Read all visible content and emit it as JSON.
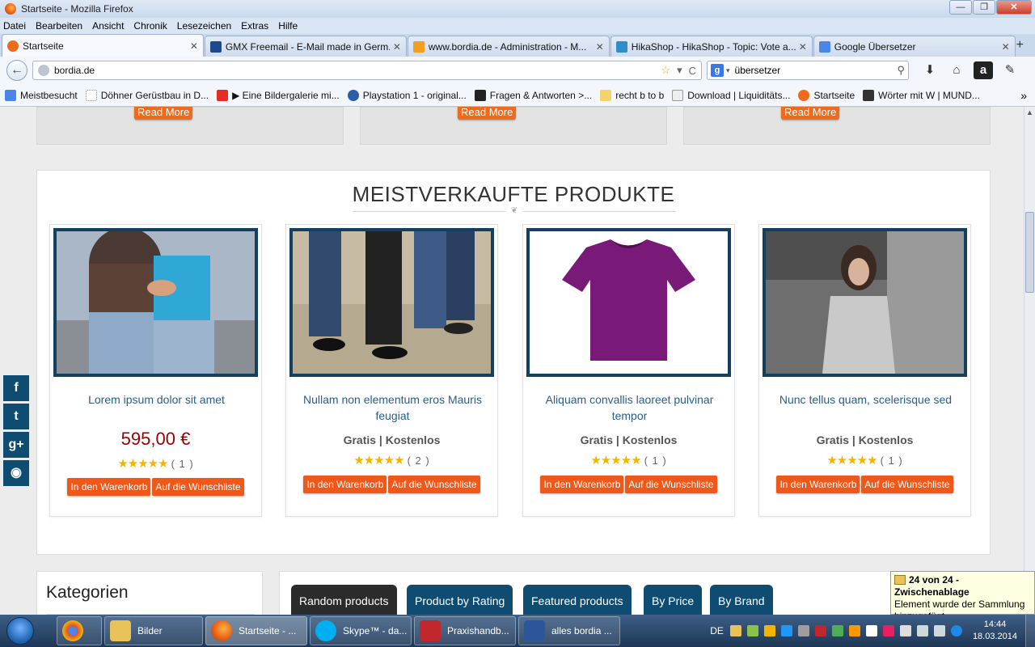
{
  "window": {
    "title": "Startseite - Mozilla Firefox",
    "min": "—",
    "max": "❐",
    "close": "✕"
  },
  "menu": [
    "Datei",
    "Bearbeiten",
    "Ansicht",
    "Chronik",
    "Lesezeichen",
    "Extras",
    "Hilfe"
  ],
  "tabs": [
    {
      "label": "Startseite",
      "color": "#f06a1c",
      "close": "✕"
    },
    {
      "label": "GMX Freemail - E-Mail made in Germ...",
      "color": "#1c4a8c",
      "close": "✕"
    },
    {
      "label": "www.bordia.de - Administration - M...",
      "color": "#f0a020",
      "close": "✕"
    },
    {
      "label": "HikaShop - HikaShop - Topic: Vote a...",
      "color": "#2c8fc9",
      "close": "✕"
    },
    {
      "label": "Google Übersetzer",
      "color": "#4a86e8",
      "close": "✕"
    }
  ],
  "newtab": "+",
  "nav": {
    "back": "←",
    "url": "bordia.de",
    "star": "☆",
    "dropdown": "▾",
    "reload": "C",
    "search_engine": "g",
    "search_value": "übersetzer",
    "search_caret": "▾",
    "search_btn": "⚲",
    "icons": [
      "⬇",
      "⌂",
      "a",
      "✎"
    ]
  },
  "bookmarks": [
    {
      "label": "Meistbesucht",
      "color": "#4a86e8"
    },
    {
      "label": "Döhner Gerüstbau in D...",
      "color": "#dddddd"
    },
    {
      "label": "▶ Eine Bildergalerie mi...",
      "color": "#e52d27"
    },
    {
      "label": "Playstation 1 - original...",
      "color": "#2c5fa8"
    },
    {
      "label": "Fragen & Antworten >...",
      "color": "#222222"
    },
    {
      "label": "recht b to b",
      "color": "#f3d36b"
    },
    {
      "label": "Download | Liquiditäts...",
      "color": "#eeeeee"
    },
    {
      "label": "Startseite",
      "color": "#f06a1c"
    },
    {
      "label": "Wörter mit W | MUND...",
      "color": "#333333"
    }
  ],
  "bookmarks_more": "»",
  "page": {
    "read_more": "Read More",
    "bestsellers_title": "MEISTVERKAUFTE PRODUKTE",
    "ornament": "❦",
    "products": [
      {
        "name": "Lorem ipsum dolor sit amet",
        "price": "595,00 €",
        "stars": "★★★★★",
        "count": "( 1 )"
      },
      {
        "name": "Nullam non elementum eros Mauris feugiat",
        "price": "Gratis | Kostenlos",
        "stars": "★★★★★",
        "count": "( 2 )"
      },
      {
        "name": "Aliquam convallis laoreet pulvinar tempor",
        "price": "Gratis | Kostenlos",
        "stars": "★★★★★",
        "count": "( 1 )"
      },
      {
        "name": "Nunc tellus quam, scelerisque sed",
        "price": "Gratis | Kostenlos",
        "stars": "★★★★★",
        "count": "( 1 )"
      }
    ],
    "cart_btn": "In den Warenkorb",
    "wish_btn": "Auf die Wunschliste",
    "categories_title": "Kategorien",
    "product_tabs": [
      "Random products",
      "Product by Rating",
      "Featured products",
      "By Price",
      "By Brand"
    ],
    "social": [
      "f",
      "t",
      "g+",
      "◉"
    ]
  },
  "notification": {
    "title": "24 von 24 - Zwischenablage",
    "body": "Element wurde der Sammlung hinzugefügt."
  },
  "taskbar": {
    "apps": [
      {
        "label": "",
        "color": "#dd4b39"
      },
      {
        "label": "Bilder",
        "color": "#e8c35a"
      },
      {
        "label": "Startseite - ...",
        "color": "#f06a1c"
      },
      {
        "label": "Skype™ - da...",
        "color": "#00aff0"
      },
      {
        "label": "Praxishandb...",
        "color": "#c0272d"
      },
      {
        "label": "alles bordia ...",
        "color": "#2b579a"
      }
    ],
    "lang": "DE",
    "time": "14:44",
    "date": "18.03.2014"
  }
}
